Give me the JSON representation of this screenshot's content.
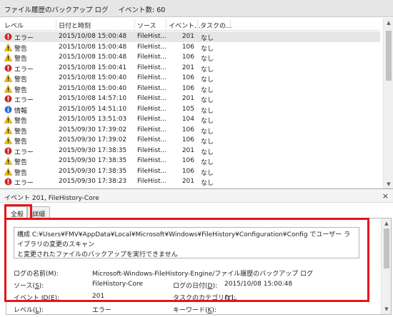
{
  "header": {
    "title": "ファイル履歴のバックアップ ログ",
    "event_count": "イベント数: 60"
  },
  "columns": {
    "level": "レベル",
    "date": "日付と時刻",
    "source": "ソース",
    "event_id": "イベント...",
    "task": "タスクの..."
  },
  "rows": [
    {
      "level": "エラー",
      "icon": "error-icon",
      "date": "2015/10/08 15:00:48",
      "source": "FileHist...",
      "id": "201",
      "task": "なし"
    },
    {
      "level": "警告",
      "icon": "warning-icon",
      "date": "2015/10/08 15:00:48",
      "source": "FileHist...",
      "id": "106",
      "task": "なし"
    },
    {
      "level": "警告",
      "icon": "warning-icon",
      "date": "2015/10/08 15:00:48",
      "source": "FileHist...",
      "id": "106",
      "task": "なし"
    },
    {
      "level": "エラー",
      "icon": "error-icon",
      "date": "2015/10/08 15:00:41",
      "source": "FileHist...",
      "id": "201",
      "task": "なし"
    },
    {
      "level": "警告",
      "icon": "warning-icon",
      "date": "2015/10/08 15:00:40",
      "source": "FileHist...",
      "id": "106",
      "task": "なし"
    },
    {
      "level": "警告",
      "icon": "warning-icon",
      "date": "2015/10/08 15:00:40",
      "source": "FileHist...",
      "id": "106",
      "task": "なし"
    },
    {
      "level": "エラー",
      "icon": "error-icon",
      "date": "2015/10/08 14:57:10",
      "source": "FileHist...",
      "id": "201",
      "task": "なし"
    },
    {
      "level": "情報",
      "icon": "info-icon",
      "date": "2015/10/05 14:51:10",
      "source": "FileHist...",
      "id": "105",
      "task": "なし"
    },
    {
      "level": "警告",
      "icon": "warning-icon",
      "date": "2015/10/05 13:51:03",
      "source": "FileHist...",
      "id": "104",
      "task": "なし"
    },
    {
      "level": "警告",
      "icon": "warning-icon",
      "date": "2015/09/30 17:39:02",
      "source": "FileHist...",
      "id": "106",
      "task": "なし"
    },
    {
      "level": "警告",
      "icon": "warning-icon",
      "date": "2015/09/30 17:39:02",
      "source": "FileHist...",
      "id": "106",
      "task": "なし"
    },
    {
      "level": "エラー",
      "icon": "error-icon",
      "date": "2015/09/30 17:38:35",
      "source": "FileHist...",
      "id": "201",
      "task": "なし"
    },
    {
      "level": "警告",
      "icon": "warning-icon",
      "date": "2015/09/30 17:38:35",
      "source": "FileHist...",
      "id": "106",
      "task": "なし"
    },
    {
      "level": "警告",
      "icon": "warning-icon",
      "date": "2015/09/30 17:38:35",
      "source": "FileHist...",
      "id": "106",
      "task": "なし"
    },
    {
      "level": "エラー",
      "icon": "error-icon",
      "date": "2015/09/30 17:38:23",
      "source": "FileHist...",
      "id": "201",
      "task": "なし"
    },
    {
      "level": "警告",
      "icon": "warning-icon",
      "date": "2015/09/30 17:38:22",
      "source": "FileHist...",
      "id": "106",
      "task": "なし"
    }
  ],
  "detail": {
    "title": "イベント 201, FileHistory-Core",
    "close": "×",
    "tabs": {
      "general": "全般",
      "details": "詳細"
    },
    "description_line1": "構成 C:¥Users¥FMV¥AppData¥Local¥Microsoft¥Windows¥FileHistory¥Configuration¥Config でユーザー ライブラリの変更のスキャン",
    "description_line2": "と変更されたファイルのバックアップを実行できません",
    "props": {
      "log_name_label": "ログの名前(M):",
      "log_name_value": "Microsoft-Windows-FileHistory-Engine/ファイル履歴のバックアップ ログ",
      "source_label_pre": "ソース(",
      "source_label_key": "S",
      "source_label_post": "):",
      "source_value": "FileHistory-Core",
      "logged_label_pre": "ログの日付(",
      "logged_label_key": "D",
      "logged_label_post": "):",
      "logged_value": "2015/10/08 15:00:48",
      "eventid_label_pre": "イベント ID(",
      "eventid_label_key": "E",
      "eventid_label_post": "):",
      "eventid_value": "201",
      "category_label": "タスクのカテゴリ(Y):",
      "category_value": "なし",
      "level_label_pre": "レベル(",
      "level_label_key": "L",
      "level_label_post": "):",
      "level_value": "エラー",
      "keywords_label_pre": "キーワード(",
      "keywords_label_key": "K",
      "keywords_label_post": "):"
    }
  },
  "colors": {
    "highlight": "#e8131b",
    "error": "#c62828",
    "warning": "#f4c20d",
    "info": "#2a6fd6"
  }
}
